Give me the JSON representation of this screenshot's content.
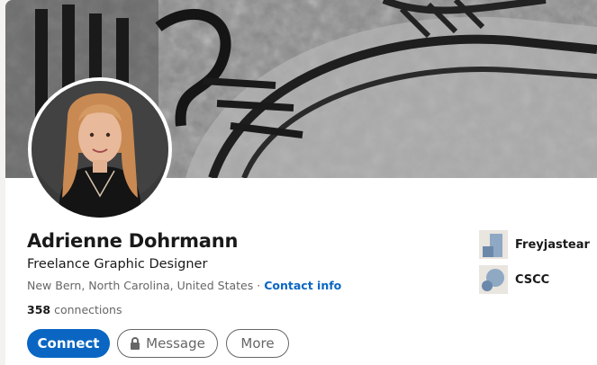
{
  "profile": {
    "name": "Adrienne Dohrmann",
    "headline": "Freelance Graphic Designer",
    "location": "New Bern, North Carolina, United States",
    "separator": "·",
    "contact_info": "Contact info",
    "connections_count": "358",
    "connections_label": "connections"
  },
  "actions": {
    "connect": "Connect",
    "message": "Message",
    "more": "More"
  },
  "orgs": [
    {
      "name": "Freyjastear",
      "logo": "company-logo"
    },
    {
      "name": "CSCC",
      "logo": "school-logo"
    }
  ],
  "colors": {
    "primary": "#0a66c2",
    "text": "#191919",
    "muted": "#666666"
  }
}
